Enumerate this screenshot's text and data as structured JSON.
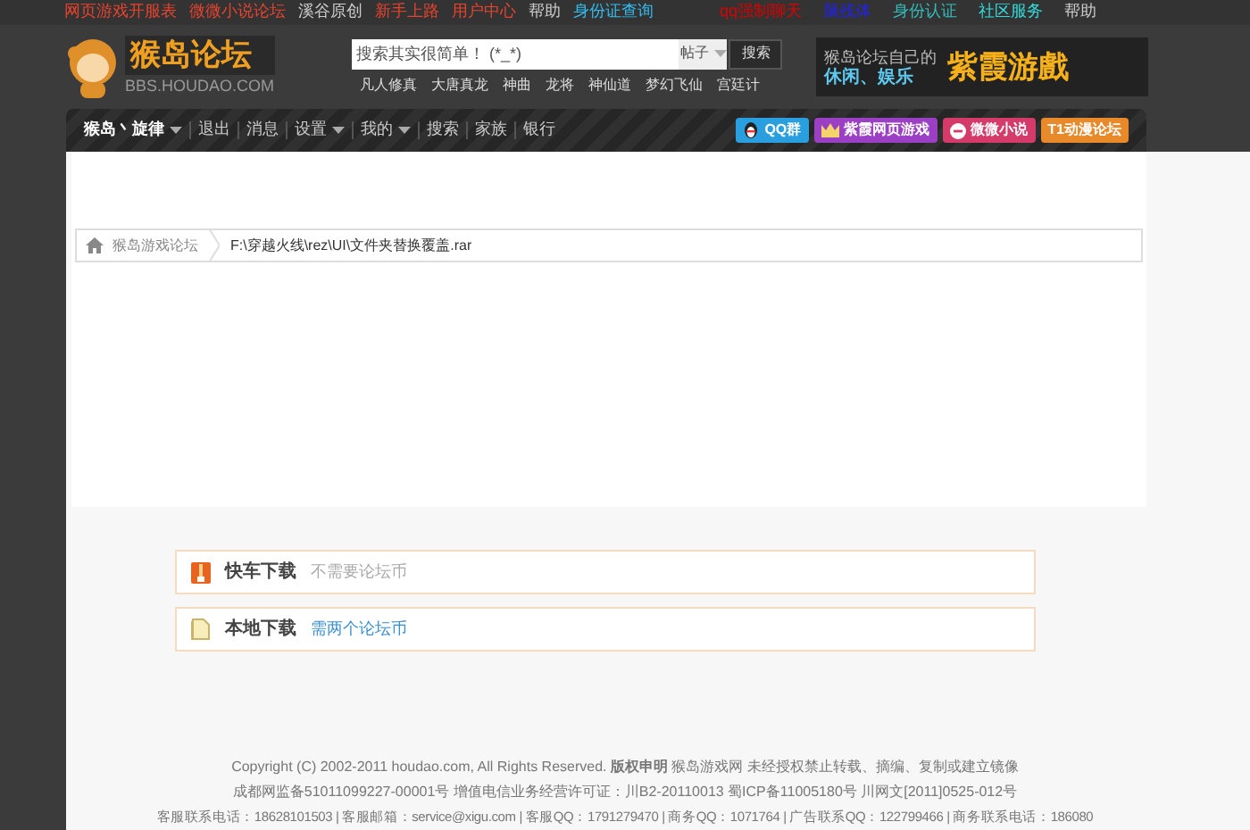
{
  "top_links": {
    "left": [
      {
        "label": "网页游戏开服表",
        "color": "#e8432e"
      },
      {
        "label": "微微小说论坛",
        "color": "#e8432e"
      },
      {
        "label": "溪谷原创",
        "color": "#cccccc"
      },
      {
        "label": "新手上路",
        "color": "#e8432e"
      },
      {
        "label": "用户中心",
        "color": "#e8432e"
      },
      {
        "label": "帮助",
        "color": "#cccccc"
      },
      {
        "label": "身份证查询",
        "color": "#33bbee"
      }
    ],
    "right": [
      {
        "label": "qq强制聊天",
        "color": "#dd0000"
      },
      {
        "label": "脑残体",
        "color": "#2222ee"
      },
      {
        "label": "身份认证",
        "color": "#33bbbb"
      },
      {
        "label": "社区服务",
        "color": "#33dddd"
      },
      {
        "label": "帮助",
        "color": "#cccccc"
      }
    ]
  },
  "logo": {
    "title": "猴岛论坛",
    "subtitle": "BBS.HOUDAO.COM"
  },
  "search": {
    "placeholder": "搜索其实很简单！ (*_*)",
    "scope": "帖子",
    "button": "搜索",
    "hot_words": [
      "凡人修真",
      "大唐真龙",
      "神曲",
      "龙将",
      "神仙道",
      "梦幻飞仙",
      "宫廷计"
    ]
  },
  "banner": {
    "line_1": "猴岛论坛自己的",
    "line_2": "休闲、娱乐",
    "headline": "紫霞游戲"
  },
  "nav": {
    "items": [
      {
        "label": "猴岛丶旋律",
        "dropdown": true,
        "bold": true
      },
      {
        "label": "退出",
        "dropdown": false,
        "bold": false
      },
      {
        "label": "消息",
        "dropdown": false,
        "bold": false
      },
      {
        "label": "设置",
        "dropdown": true,
        "bold": false
      },
      {
        "label": "我的",
        "dropdown": true,
        "bold": false
      },
      {
        "label": "搜索",
        "dropdown": false,
        "bold": false
      },
      {
        "label": "家族",
        "dropdown": false,
        "bold": false
      },
      {
        "label": "银行",
        "dropdown": false,
        "bold": false
      }
    ],
    "badges": [
      {
        "label": "QQ群",
        "color": "#2a9fe0"
      },
      {
        "label": "紫霞网页游戏",
        "color": "#9b3fc4"
      },
      {
        "label": "微微小说",
        "color": "#d43a6a"
      },
      {
        "label": "T1动漫论坛",
        "color": "#e8892a"
      }
    ]
  },
  "breadcrumb": [
    "猴岛游戏论坛",
    "F:\\穿越火线\\rez\\UI\\文件夹替换覆盖.rar"
  ],
  "downloads": [
    {
      "kind": "express",
      "title": "快车下载",
      "note": "不需要论坛币",
      "link": false
    },
    {
      "kind": "local",
      "title": "本地下载",
      "note": "需两个论坛币",
      "link": true
    }
  ],
  "footer": {
    "copyright": "Copyright (C) 2002-2011 houdao.com, All Rights Reserved. **版权申明** 猴岛游戏网 未经授权禁止转载、摘编、复制或建立镜像",
    "licenses": "成都网监备51011099227-00001号 增值电信业务经营许可证：川B2-20110013 蜀ICP备11005180号 川网文[2011]0525-012号",
    "contacts": "客服联系电话：18628101503 | 客服邮箱：service@xigu.com | 客服QQ：1791279470 | 商务QQ：1071764 | 广告联系QQ：122799466 | 商务联系电话：186080"
  }
}
